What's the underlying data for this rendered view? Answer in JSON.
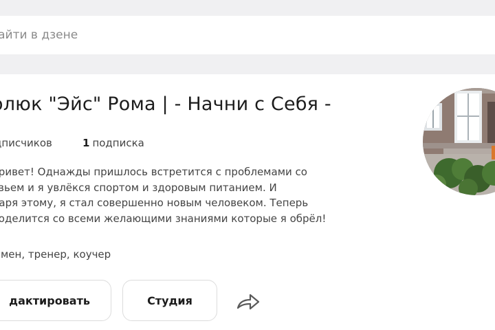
{
  "search": {
    "placeholder": "найти в дзене"
  },
  "profile": {
    "title": "олюк \"Эйс\" Рома | - Начни с Себя -",
    "subscribers_label": "дписчиков",
    "subscriptions_count": "1",
    "subscriptions_label": "подписка",
    "description_lines": [
      "привет! Однажды пришлось встретится с проблемами со",
      "овьем и я увлёкся спортом и здоровым питанием. И",
      "даря этому, я стал совершенно новым человеком. Теперь",
      "поделится со всеми желающими знаниями которые я обрёл!"
    ],
    "tags": "тсмен, тренер, коучер"
  },
  "actions": {
    "edit_label": "дактировать",
    "studio_label": "Студия",
    "share_icon": "share-arrow-icon"
  },
  "colors": {
    "page_background": "#f0f0f2",
    "card_background": "#ffffff",
    "text_primary": "#1c1c1c",
    "text_secondary": "#444444",
    "placeholder": "#8a8a8a",
    "button_border": "#dcdcdc"
  }
}
